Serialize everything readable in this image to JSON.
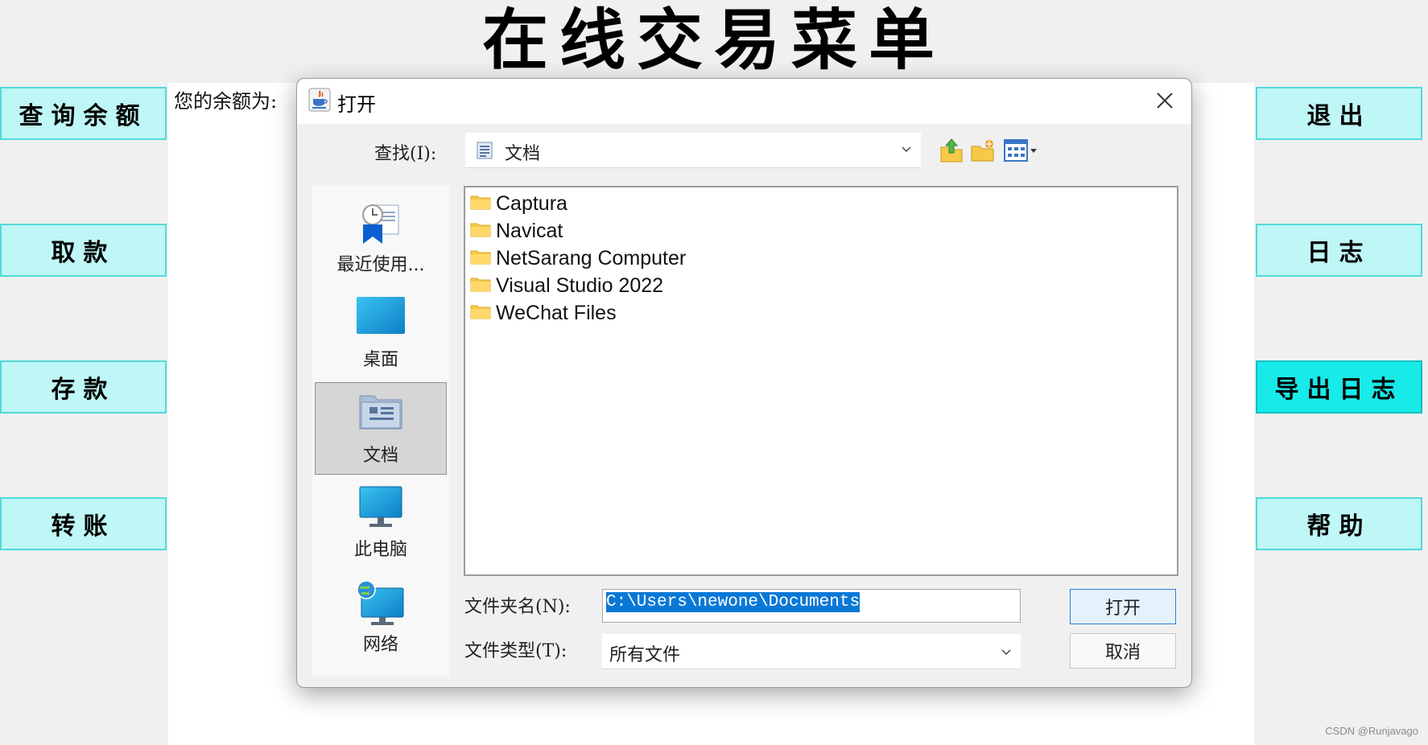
{
  "app": {
    "title": "在线交易菜单",
    "balance_label": "您的余额为:"
  },
  "left_buttons": [
    "查询余额",
    "取款",
    "存款",
    "转账"
  ],
  "right_buttons": [
    "退出",
    "日志",
    "导出日志",
    "帮助"
  ],
  "active_button": "导出日志",
  "dialog": {
    "title": "打开",
    "look_in_label": "查找(I):",
    "look_in_value": "文档",
    "places": [
      "最近使用...",
      "桌面",
      "文档",
      "此电脑",
      "网络"
    ],
    "selected_place": "文档",
    "files": [
      "Captura",
      "Navicat",
      "NetSarang Computer",
      "Visual Studio 2022",
      "WeChat Files"
    ],
    "filename_label": "文件夹名(N):",
    "filename_value": "C:\\Users\\newone\\Documents",
    "filetype_label": "文件类型(T):",
    "filetype_value": "所有文件",
    "open_button": "打开",
    "cancel_button": "取消"
  },
  "icons": {
    "java": "java-cup-icon",
    "close": "close-icon",
    "up": "up-folder-icon",
    "new_folder": "new-folder-icon",
    "view": "view-menu-icon"
  },
  "colors": {
    "side_button_bg": "#bff6f6",
    "side_button_active_bg": "#18e9e9",
    "selection": "#0a78d7",
    "folder": "#f7c948"
  },
  "watermark": "CSDN @Runjavago"
}
